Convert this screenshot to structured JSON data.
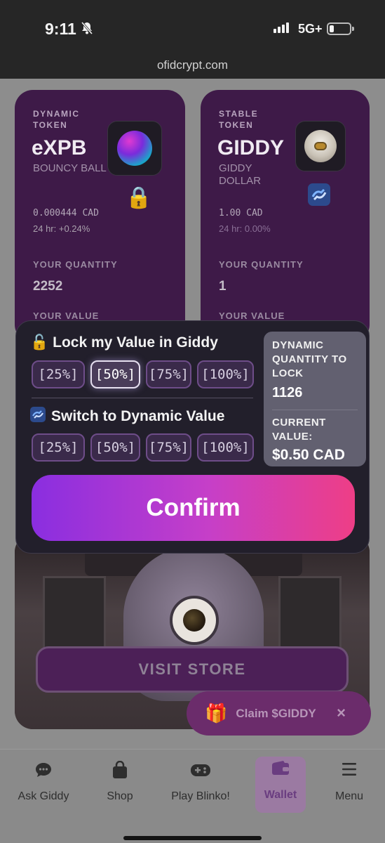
{
  "status_bar": {
    "time": "9:11",
    "network": "5G+"
  },
  "browser": {
    "url": "ofidcrypt.com"
  },
  "tokens": [
    {
      "type_label": "DYNAMIC TOKEN",
      "symbol": "eXPB",
      "name": "BOUNCY BALL",
      "price": "0.000444 CAD",
      "change": "24 hr: +0.24%",
      "quantity_label": "YOUR QUANTITY",
      "quantity": "2252",
      "value_label": "YOUR VALUE"
    },
    {
      "type_label": "STABLE TOKEN",
      "symbol": "GIDDY",
      "name": "GIDDY DOLLAR",
      "price": "1.00 CAD",
      "change": "24 hr: 0.00%",
      "quantity_label": "YOUR QUANTITY",
      "quantity": "1",
      "value_label": "YOUR VALUE"
    }
  ],
  "modal": {
    "lock_title": "Lock my Value in Giddy",
    "lock_options": [
      "[25%]",
      "[50%]",
      "[75%]",
      "[100%]"
    ],
    "lock_selected": "[50%]",
    "switch_title": "Switch to Dynamic Value",
    "switch_options": [
      "[25%]",
      "[50%]",
      "[75%]",
      "[100%]"
    ],
    "info": {
      "qty_label": "DYNAMIC QUANTITY TO LOCK",
      "qty_value": "1126",
      "value_label": "CURRENT VALUE:",
      "value_amount": "$0.50 CAD"
    },
    "confirm_label": "Confirm"
  },
  "store": {
    "visit_label": "VISIT STORE"
  },
  "claim": {
    "label": "Claim $GIDDY",
    "close": "×"
  },
  "nav": {
    "items": [
      {
        "label": "Ask Giddy",
        "icon": "chat-icon"
      },
      {
        "label": "Shop",
        "icon": "shopping-bag-icon"
      },
      {
        "label": "Play Blinko!",
        "icon": "gamepad-icon"
      },
      {
        "label": "Wallet",
        "icon": "wallet-icon",
        "active": true
      },
      {
        "label": "Menu",
        "icon": "hamburger-icon"
      }
    ]
  },
  "colors": {
    "accent_purple": "#8a2ee0",
    "accent_pink": "#ee3e86",
    "modal_bg": "#221f2b",
    "card_bg": "#3e1a48"
  }
}
